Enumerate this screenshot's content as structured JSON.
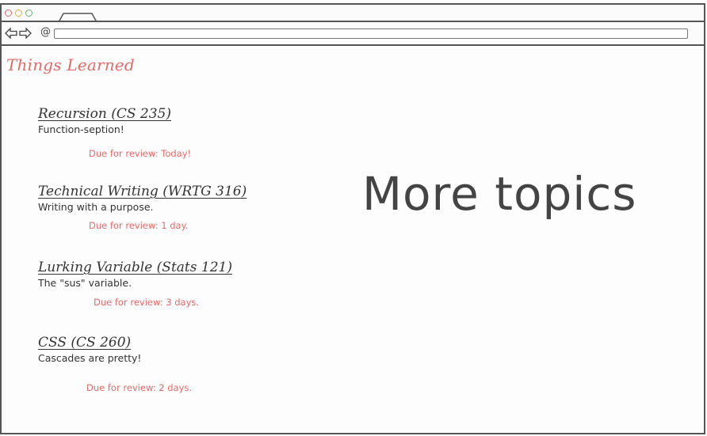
{
  "browser": {
    "url_value": ""
  },
  "page": {
    "title": "Things Learned",
    "more_topics_label": "More topics"
  },
  "topics": [
    {
      "heading": "Recursion (CS 235)",
      "description": "Function-seption!",
      "due": "Due for review: Today!"
    },
    {
      "heading": "Technical Writing (WRTG 316)",
      "description": "Writing with a purpose.",
      "due": "Due for review: 1 day."
    },
    {
      "heading": "Lurking Variable (Stats 121)",
      "description": "The \"sus\" variable.",
      "due": "Due for review: 3 days."
    },
    {
      "heading": "CSS (CS 260)",
      "description": "Cascades are pretty!",
      "due": "Due for review: 2 days."
    }
  ],
  "colors": {
    "accent": "#e46a6a",
    "text": "#333333",
    "chrome_border": "#555555"
  },
  "icons": {
    "window_controls": [
      "close-dot-icon",
      "minimize-dot-icon",
      "maximize-dot-icon"
    ],
    "nav": [
      "back-arrow-icon",
      "forward-arrow-icon",
      "at-sign-icon"
    ]
  }
}
